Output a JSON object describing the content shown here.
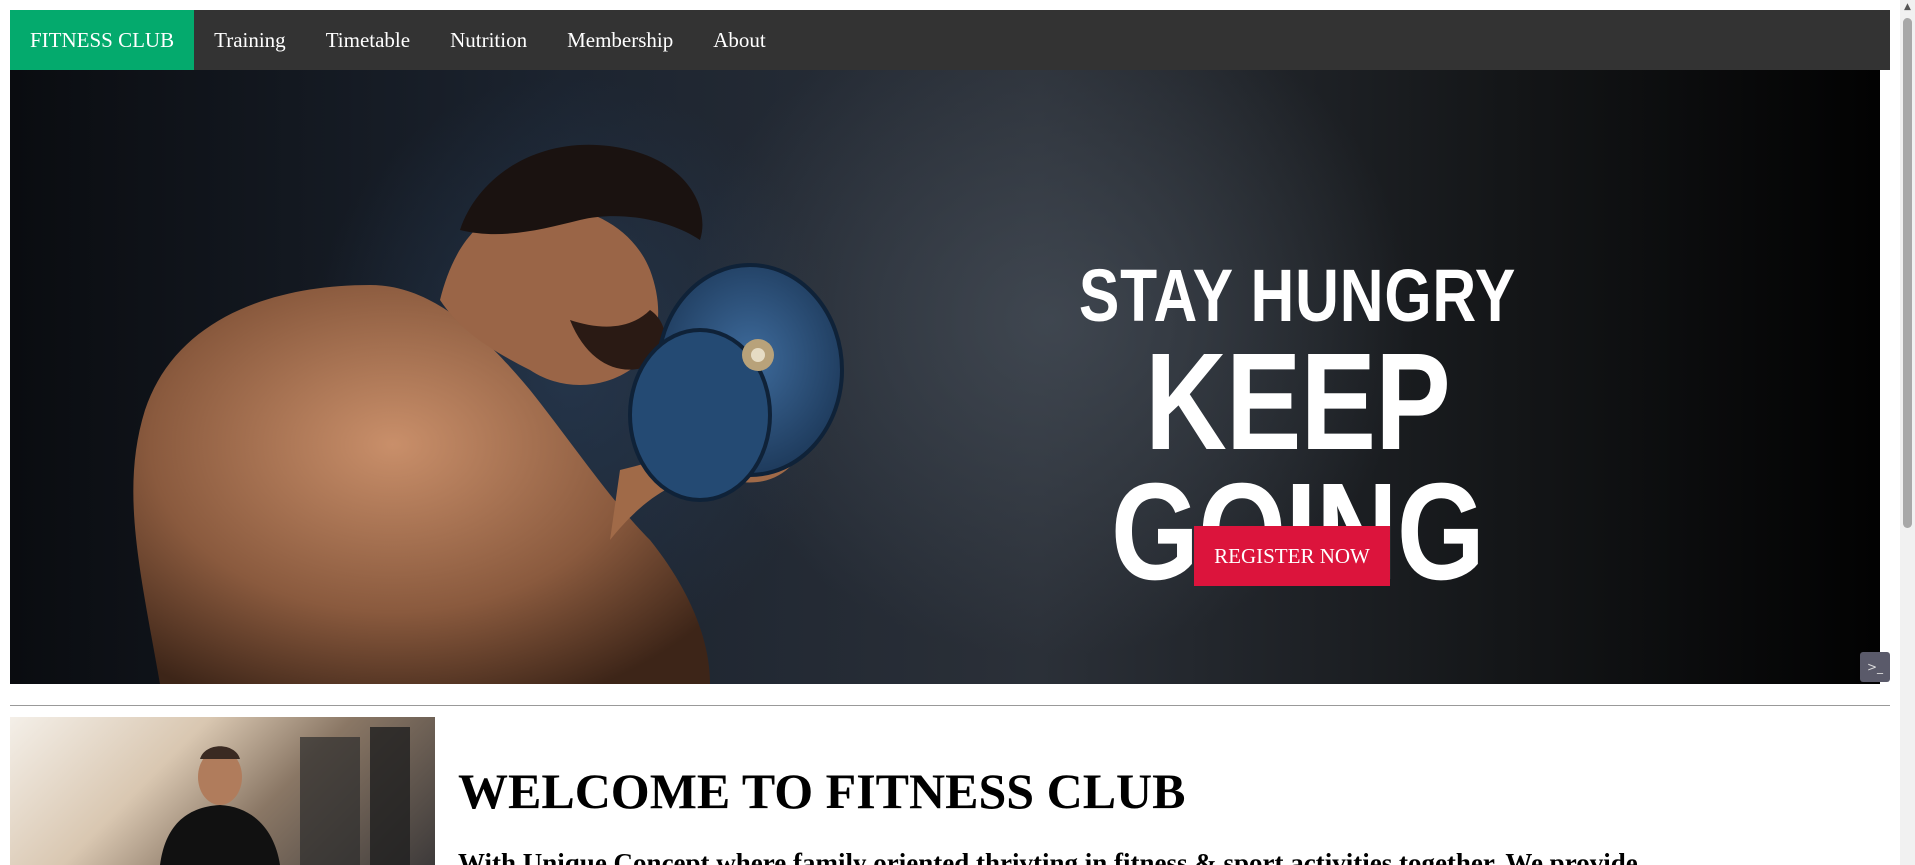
{
  "nav": {
    "brand": "FITNESS CLUB",
    "links": [
      "Training",
      "Timetable",
      "Nutrition",
      "Membership",
      "About"
    ]
  },
  "hero": {
    "line1": "STAY HUNGRY",
    "line2": "KEEP GOING",
    "register_label": "REGISTER NOW"
  },
  "welcome": {
    "title": "WELCOME TO FITNESS CLUB",
    "paragraph": "With Unique Concept where family oriented thrivting in fitness & sport activities together. We provide"
  },
  "colors": {
    "brand": "#04AA6D",
    "nav_bg": "#333333",
    "accent": "#DC143C"
  },
  "icons": {
    "scroll_up": "scroll-up-arrow-icon",
    "corner_widget": "terminal-icon"
  }
}
